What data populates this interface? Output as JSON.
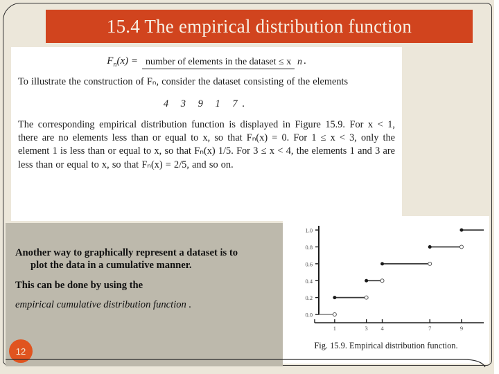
{
  "slide": {
    "title": "15.4 The empirical distribution function",
    "page_number": "12",
    "title_bg": "#d1441e",
    "title_color": "#f7f2e6",
    "background": "#ece7da",
    "note_panel_bg": "#bdb9ac",
    "page_bubble_bg": "#e0541f"
  },
  "textbook": {
    "formula": {
      "lhs": "F",
      "lhs_sub": "n",
      "lhs_arg": "(x) =",
      "numerator": "number of elements in the dataset ≤ x",
      "denominator": "n",
      "trailing": "."
    },
    "intro_paragraph": "To illustrate the construction of Fₙ, consider the dataset consisting of the elements",
    "dataset": "4 3 9 1 7.",
    "body_paragraph": "The corresponding empirical distribution function is displayed in Figure 15.9. For x < 1, there are no elements less than or equal to x, so that Fₙ(x) = 0. For 1 ≤ x < 3, only the element 1 is less than or equal to x, so that Fₙ(x)  1/5. For 3 ≤ x < 4, the elements 1 and 3 are less than or equal to x, so that Fₙ(x) = 2/5, and so on."
  },
  "notes": {
    "line1_main": "Another way to graphically represent a dataset is to",
    "line1_indent": "plot the data in a cumulative manner.",
    "line2": "This can be done by using the",
    "line3_italic": "empirical cumulative distribution function ."
  },
  "chart_data": {
    "type": "line",
    "title": "",
    "caption": "Fig. 15.9. Empirical distribution function.",
    "xlabel": "",
    "ylabel": "",
    "xlim": [
      0,
      10.4
    ],
    "ylim": [
      0.0,
      1.05
    ],
    "grid": false,
    "legend": null,
    "x_ticks": [
      1,
      3,
      4,
      7,
      9
    ],
    "x_tick_labels": [
      "1",
      "3",
      "4",
      "7",
      "9"
    ],
    "y_ticks": [
      0.0,
      0.2,
      0.4,
      0.6,
      0.8,
      1.0
    ],
    "y_tick_labels": [
      "0.0",
      "0.2",
      "0.4",
      "0.6",
      "0.8",
      "1.0"
    ],
    "dataset": [
      1,
      3,
      4,
      7,
      9
    ],
    "steps": [
      {
        "y": 0.0,
        "x_start": 0.0,
        "x_end": 1,
        "left_closed": false,
        "right_open": true
      },
      {
        "y": 0.2,
        "x_start": 1,
        "x_end": 3,
        "left_closed": true,
        "right_open": true
      },
      {
        "y": 0.4,
        "x_start": 3,
        "x_end": 4,
        "left_closed": true,
        "right_open": true
      },
      {
        "y": 0.6,
        "x_start": 4,
        "x_end": 7,
        "left_closed": true,
        "right_open": true
      },
      {
        "y": 0.8,
        "x_start": 7,
        "x_end": 9,
        "left_closed": true,
        "right_open": true
      },
      {
        "y": 1.0,
        "x_start": 9,
        "x_end": 10.4,
        "left_closed": true,
        "right_open": false
      }
    ]
  }
}
